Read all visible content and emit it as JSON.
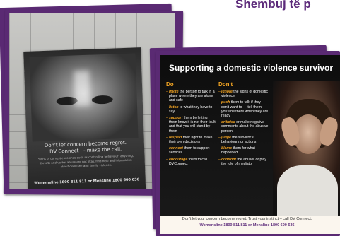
{
  "heading": "Shembuj të p",
  "poster": {
    "tagline_1": "Don't let concern become regret.",
    "tagline_2": "DV Connect — make the call.",
    "body_text": "Signs of domestic violence such as controlling behaviour, anything, threats and verbal abuse are not okay. Find help and information about domestic and family violence.",
    "helplines": "Womensline 1800 811 811 or Mensline 1800 600 636"
  },
  "slide": {
    "title": "Supporting a domestic violence survivor",
    "do_heading": "Do",
    "dont_heading": "Don't",
    "do_items": [
      {
        "verb": "invite",
        "rest": " the person to talk in a place where they are alone and safe"
      },
      {
        "verb": "listen",
        "rest": " to what they have to say"
      },
      {
        "verb": "support",
        "rest": " them by letting them know it is not their fault and that you will stand by them"
      },
      {
        "verb": "respect",
        "rest": " their right to make their own decisions"
      },
      {
        "verb": "connect",
        "rest": " them to support services"
      },
      {
        "verb": "encourage",
        "rest": " them to call DVConnect"
      }
    ],
    "dont_items": [
      {
        "verb": "ignore",
        "rest": " the signs of domestic violence"
      },
      {
        "verb": "push",
        "rest": " them to talk if they don't want to — tell them you'll be there when they are ready"
      },
      {
        "verb": "criticise",
        "rest": " or make negative comments about the abusive person"
      },
      {
        "verb": "judge",
        "rest": " the survivor's behaviours or actions"
      },
      {
        "verb": "blame",
        "rest": " them for what happened"
      },
      {
        "verb": "confront",
        "rest": " the abuser or play the role of mediator"
      }
    ],
    "footer_1": "Don't let your concern become regret. Trust your instinct – call DV Connect.",
    "footer_2": "Womensline 1800 811 811 or Mensline 1800 600 636"
  }
}
